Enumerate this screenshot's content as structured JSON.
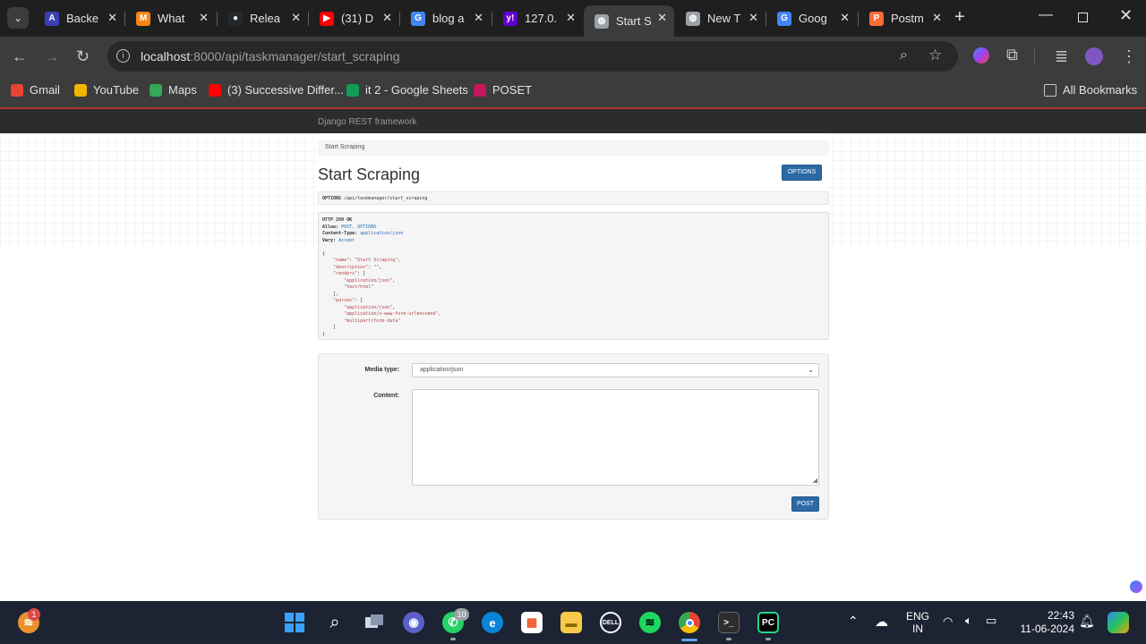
{
  "browser": {
    "tabs": [
      {
        "title": "Backe",
        "icon": "a-logo-icon",
        "color": "#3b3fb6",
        "glyph": "A"
      },
      {
        "title": "What",
        "icon": "metamask-icon",
        "color": "#f6851b",
        "glyph": "M"
      },
      {
        "title": "Relea",
        "icon": "github-icon",
        "color": "#24292e",
        "glyph": "●"
      },
      {
        "title": "(31) D",
        "icon": "youtube-icon",
        "color": "#ff0000",
        "glyph": "▶"
      },
      {
        "title": "blog a",
        "icon": "google-icon",
        "color": "#4285f4",
        "glyph": "G"
      },
      {
        "title": "127.0.",
        "icon": "yahoo-icon",
        "color": "#6001d2",
        "glyph": "y!"
      },
      {
        "title": "Start S",
        "icon": "globe-icon",
        "color": "#9aa0a6",
        "glyph": "◍"
      },
      {
        "title": "New T",
        "icon": "globe-icon",
        "color": "#9aa0a6",
        "glyph": "◍"
      },
      {
        "title": "Goog",
        "icon": "google-icon",
        "color": "#4285f4",
        "glyph": "G"
      },
      {
        "title": "Postm",
        "icon": "postman-icon",
        "color": "#ff6c37",
        "glyph": "P"
      }
    ],
    "active_tab": 6,
    "url_host": "localhost",
    "url_path": ":8000/api/taskmanager/start_scraping",
    "bookmarks": [
      {
        "label": "Gmail",
        "color": "#ea4335"
      },
      {
        "label": "YouTube",
        "color": "#f4b400"
      },
      {
        "label": "Maps",
        "color": "#34a853"
      },
      {
        "label": "(3) Successive Differ...",
        "color": "#ff0000"
      },
      {
        "label": "it 2 - Google Sheets",
        "color": "#0f9d58"
      },
      {
        "label": "POSET",
        "color": "#c2185b"
      }
    ],
    "all_bookmarks": "All Bookmarks"
  },
  "drf": {
    "brand": "Django REST framework",
    "breadcrumb": "Start Scraping",
    "title": "Start Scraping",
    "options_btn": "OPTIONS",
    "request_method": "OPTIONS",
    "request_path": "/api/taskmanager/start_scraping",
    "response": {
      "status": "HTTP 200 OK",
      "allow_key": "Allow:",
      "allow_val": "POST, OPTIONS",
      "ctype_key": "Content-Type:",
      "ctype_val": "application/json",
      "vary_key": "Vary:",
      "vary_val": "Accept",
      "name_key": "\"name\"",
      "name_val": "\"Start Scraping\"",
      "desc_key": "\"description\"",
      "desc_val": "\"\"",
      "renders_key": "\"renders\"",
      "renders": [
        "\"application/json\"",
        "\"text/html\""
      ],
      "parses_key": "\"parses\"",
      "parses": [
        "\"application/json\"",
        "\"application/x-www-form-urlencoded\"",
        "\"multipart/form-data\""
      ]
    },
    "form": {
      "media_label": "Media type:",
      "media_value": "application/json",
      "content_label": "Content:",
      "post_btn": "POST"
    }
  },
  "taskbar": {
    "weather_badge": "1",
    "whatsapp_badge": "10",
    "lang_1": "ENG",
    "lang_2": "IN",
    "time": "22:43",
    "date": "11-06-2024"
  }
}
